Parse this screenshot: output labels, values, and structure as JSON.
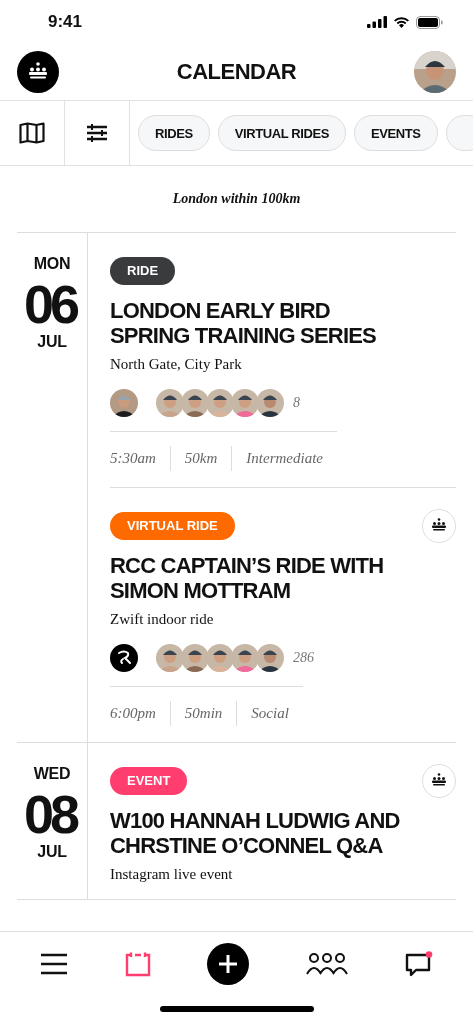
{
  "status_bar": {
    "time": "9:41"
  },
  "header": {
    "title": "CALENDAR"
  },
  "filters": {
    "chips": [
      {
        "label": "RIDES",
        "selected": false
      },
      {
        "label": "VIRTUAL RIDES",
        "selected": false
      },
      {
        "label": "EVENTS",
        "selected": false
      }
    ]
  },
  "location": "London within 100km",
  "days": [
    {
      "weekday": "MON",
      "day": "06",
      "month": "JUL",
      "events": [
        {
          "tag": "RIDE",
          "color": "#3a3b3d",
          "club_badge": false,
          "title_lines": [
            "LONDON EARLY BIRD",
            "SPRING TRAINING SERIES"
          ],
          "subtitle": "North Gate, City Park",
          "host": {
            "kind": "picture"
          },
          "attendees": [
            {
              "kind": "picture"
            },
            {
              "kind": "picture"
            },
            {
              "kind": "picture"
            },
            {
              "kind": "picture"
            },
            {
              "kind": "picture"
            }
          ],
          "count": "8",
          "meta": [
            "5:30am",
            "50km",
            "Intermediate"
          ]
        },
        {
          "tag": "VIRTUAL RIDE",
          "color": "#ff6a00",
          "club_badge": true,
          "title_lines": [
            "RCC CAPTAIN’S RIDE WITH",
            "SIMON MOTTRAM"
          ],
          "subtitle": "Zwift indoor ride",
          "host": {
            "kind": "logo"
          },
          "attendees": [
            {
              "kind": "picture"
            },
            {
              "kind": "picture"
            },
            {
              "kind": "picture"
            },
            {
              "kind": "picture"
            },
            {
              "kind": "picture"
            }
          ],
          "count": "286",
          "meta": [
            "6:00pm",
            "50min",
            "Social"
          ]
        }
      ]
    },
    {
      "weekday": "WED",
      "day": "08",
      "month": "JUL",
      "events": [
        {
          "tag": "EVENT",
          "color": "#ff3d6e",
          "club_badge": true,
          "title_lines": [
            "W100 HANNAH LUDWIG AND",
            "CHRSTINE O’CONNEL Q&A"
          ],
          "subtitle": "Instagram live event"
        }
      ]
    }
  ],
  "nav": [
    {
      "kind": "menu",
      "selected": false
    },
    {
      "kind": "calendar",
      "selected": true
    },
    {
      "kind": "add",
      "selected": false
    },
    {
      "kind": "people",
      "selected": false
    },
    {
      "kind": "messages",
      "selected": false,
      "unread": true
    }
  ]
}
